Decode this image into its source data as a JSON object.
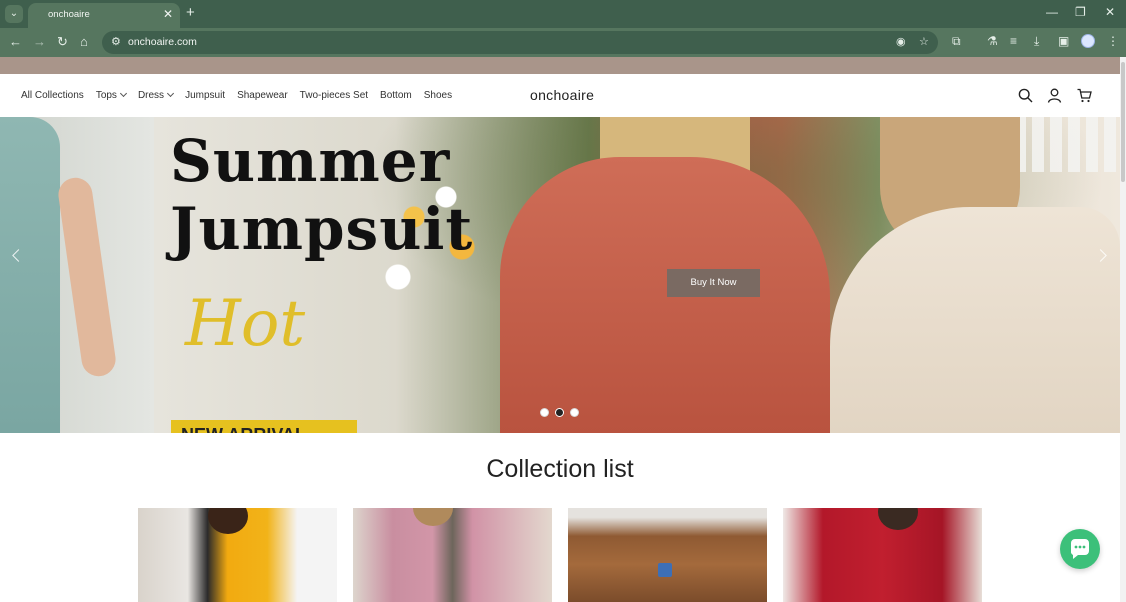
{
  "browser": {
    "tab_title": "onchoaire",
    "url": "onchoaire.com",
    "new_tab_icon": "+",
    "tab_close_icon": "✕"
  },
  "site": {
    "brand": "onchoaire",
    "nav": [
      {
        "label": "All Collections",
        "has_dropdown": false
      },
      {
        "label": "Tops",
        "has_dropdown": true
      },
      {
        "label": "Dress",
        "has_dropdown": true
      },
      {
        "label": "Jumpsuit",
        "has_dropdown": false
      },
      {
        "label": "Shapewear",
        "has_dropdown": false
      },
      {
        "label": "Two-pieces Set",
        "has_dropdown": false
      },
      {
        "label": "Bottom",
        "has_dropdown": false
      },
      {
        "label": "Shoes",
        "has_dropdown": false
      }
    ],
    "header_icons": [
      "search-icon",
      "account-icon",
      "cart-icon"
    ]
  },
  "hero": {
    "headline_line1": "Summer",
    "headline_line2": "Jumpsuit",
    "script_text": "Hot",
    "tag_text": "NEW ARRIVAL",
    "cta_label": "Buy It Now",
    "slide_count": 3,
    "active_slide": 2
  },
  "collection": {
    "title": "Collection list",
    "cards": 4
  },
  "colors": {
    "browser_chrome": "#3f5f4d",
    "announcement_bar": "#a9958a",
    "cta": "#7a6a62",
    "chat": "#3cc07a"
  }
}
